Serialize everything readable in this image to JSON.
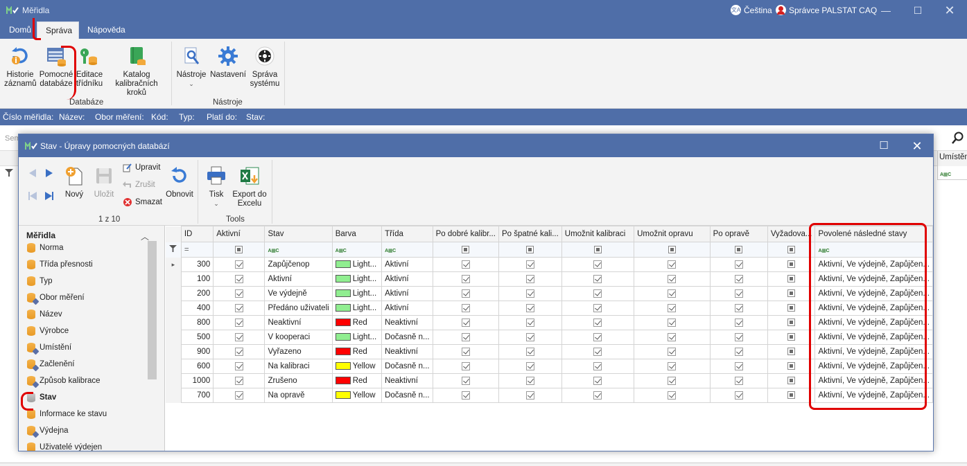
{
  "app": {
    "title": "Měřidla",
    "language": "Čeština",
    "user": "Správce PALSTAT CAQ"
  },
  "ribbon_tabs": [
    "Domů",
    "Správa",
    "Nápověda"
  ],
  "ribbon": {
    "buttons": [
      {
        "line1": "Historie",
        "line2": "záznamů"
      },
      {
        "line1": "Pomocné",
        "line2": "databáze"
      },
      {
        "line1": "Editace",
        "line2": "třídníku"
      },
      {
        "line1": "Katalog",
        "line2": "kalibračních kroků"
      },
      {
        "line1": "Nástroje",
        "line2": ""
      },
      {
        "line1": "Nastavení",
        "line2": ""
      },
      {
        "line1": "Správa",
        "line2": "systému"
      }
    ],
    "groups": [
      "Databáze",
      "Nástroje"
    ]
  },
  "filterbar": [
    "Číslo měřidla:",
    "Název:",
    "Obor měření:",
    "Kód:",
    "Typ:",
    "Platí do:",
    "Stav:"
  ],
  "search": {
    "placeholder": "Sem"
  },
  "background_grid": {
    "right_column": "Umístěn"
  },
  "dialog": {
    "title": "Stav - Úpravy pomocných databází",
    "ribbon": {
      "new": "Nový",
      "save": "Uložit",
      "edit": "Upravit",
      "cancel": "Zrušit",
      "delete": "Smazat",
      "refresh": "Obnovit",
      "print": "Tisk",
      "export_line1": "Export do",
      "export_line2": "Excelu",
      "record_counter": "1 z 10",
      "group_tools": "Tools"
    },
    "sidebar": {
      "header": "Měřidla",
      "items": [
        "Norma",
        "Třída přesnosti",
        "Typ",
        "Obor měření",
        "Název",
        "Výrobce",
        "Umístění",
        "Začlenění",
        "Způsob kalibrace",
        "Stav",
        "Informace ke stavu",
        "Výdejna",
        "Uživatelé výdejen"
      ]
    },
    "grid": {
      "columns": [
        "ID",
        "Aktivní",
        "Stav",
        "Barva",
        "Třída",
        "Po dobré kalibr...",
        "Po špatné kali...",
        "Umožnit kalibraci",
        "Umožnit opravu",
        "Po opravě",
        "Vyžadova...",
        "Povolené následné stavy"
      ],
      "filter_eq": "=",
      "rows": [
        {
          "id": "300",
          "stav": "Zapůjčenop",
          "barva": "Light...",
          "color": "#90ee90",
          "trida": "Aktivní",
          "vyz": false
        },
        {
          "id": "100",
          "stav": "Aktivní",
          "barva": "Light...",
          "color": "#90ee90",
          "trida": "Aktivní",
          "vyz": false
        },
        {
          "id": "200",
          "stav": "Ve výdejně",
          "barva": "Light...",
          "color": "#90ee90",
          "trida": "Aktivní",
          "vyz": false
        },
        {
          "id": "400",
          "stav": "Předáno uživateli",
          "barva": "Light...",
          "color": "#90ee90",
          "trida": "Aktivní",
          "vyz": false
        },
        {
          "id": "800",
          "stav": "Neaktivní",
          "barva": "Red",
          "color": "#ff0000",
          "trida": "Neaktivní",
          "vyz": false
        },
        {
          "id": "500",
          "stav": "V kooperaci",
          "barva": "Light...",
          "color": "#90ee90",
          "trida": "Dočasně n...",
          "vyz": false
        },
        {
          "id": "900",
          "stav": "Vyřazeno",
          "barva": "Red",
          "color": "#ff0000",
          "trida": "Neaktivní",
          "vyz": false
        },
        {
          "id": "600",
          "stav": "Na kalibraci",
          "barva": "Yellow",
          "color": "#ffff00",
          "trida": "Dočasně n...",
          "vyz": false
        },
        {
          "id": "1000",
          "stav": "Zrušeno",
          "barva": "Red",
          "color": "#ff0000",
          "trida": "Neaktivní",
          "vyz": false
        },
        {
          "id": "700",
          "stav": "Na opravě",
          "barva": "Yellow",
          "color": "#ffff00",
          "trida": "Dočasně n...",
          "vyz": false
        }
      ],
      "allowed_states_text": "Aktivní, Ve výdejně, Zapůjčen..."
    }
  },
  "colors": {
    "titlebar": "#4f6ea8",
    "ribbon_bg": "#f3f3f3",
    "annotation_red": "#e00000"
  }
}
